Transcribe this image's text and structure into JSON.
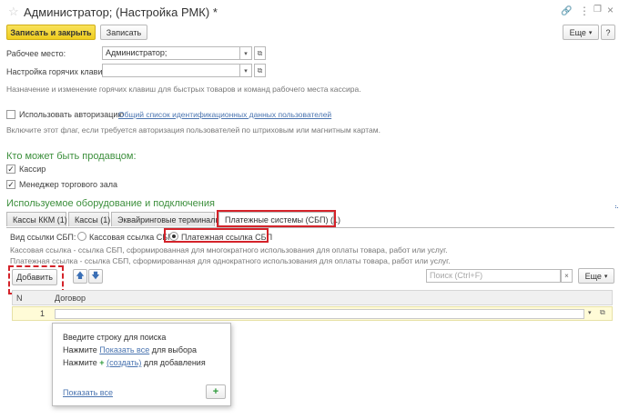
{
  "header": {
    "title": "Администратор; (Настройка РМК) *",
    "star_icon": "star-icon",
    "more_icon": "more-options-icon",
    "restore_icon": "restore-window-icon",
    "close_icon": "close-icon"
  },
  "toolbar": {
    "save_close_label": "Записать и закрыть",
    "save_label": "Записать",
    "more_label": "Еще",
    "help_label": "?"
  },
  "form": {
    "workplace_label": "Рабочее место:",
    "workplace_value": "Администратор;",
    "hotkeys_label": "Настройка горячих клавиш:",
    "hotkeys_value": "",
    "hotkeys_hint": "Назначение и изменение горячих клавиш для быстрых товаров и команд рабочего места кассира.",
    "use_auth_label": "Использовать авторизацию",
    "use_auth_checked": false,
    "user_ids_link": "Общий список идентификационных данных пользователей",
    "auth_hint": "Включите этот флаг, если требуется авторизация пользователей по штриховым или магнитным картам."
  },
  "seller": {
    "heading": "Кто может быть продавцом:",
    "options": [
      {
        "label": "Кассир",
        "checked": true
      },
      {
        "label": "Менеджер торгового зала",
        "checked": true
      }
    ]
  },
  "equipment": {
    "heading": "Используемое оборудование и подключения",
    "tabs": [
      {
        "label": "Кассы ККМ (1)",
        "active": false
      },
      {
        "label": "Кассы (1)",
        "active": false
      },
      {
        "label": "Эквайринговые терминалы",
        "active": false
      },
      {
        "label": "Платежные системы (СБП) (1)",
        "active": true
      }
    ]
  },
  "sbp": {
    "link_type_label": "Вид ссылки СБП:",
    "radio_cash": "Кассовая ссылка СБП",
    "radio_payment": "Платежная ссылка СБП",
    "selected": "payment",
    "desc_cash": "Кассовая ссылка - ссылка СБП, сформированная для многократного использования для оплаты товара, работ или услуг.",
    "desc_payment": "Платежная ссылка - ссылка СБП, сформированная для однократного использования для оплаты товара, работ или услуг."
  },
  "table_toolbar": {
    "add_label": "Добавить",
    "up_icon": "arrow-up-icon",
    "down_icon": "arrow-down-icon",
    "search_placeholder": "Поиск (Ctrl+F)",
    "more_label": "Еще"
  },
  "table": {
    "col_num": "N",
    "col_contract": "Договор",
    "rows": [
      {
        "num": "1",
        "contract": ""
      }
    ]
  },
  "popup": {
    "line1": "Введите строку для поиска",
    "line2_prefix": "Нажмите",
    "line2_link": "Показать все",
    "line2_suffix": "для выбора",
    "line3_prefix": "Нажмите",
    "line3_link": "(создать)",
    "line3_suffix": "для добавления",
    "show_all": "Показать все"
  },
  "colors": {
    "accent_yellow": "#f4d635",
    "section_green": "#3c8f3c",
    "link_blue": "#4a74b0",
    "highlight_red": "#d4232a",
    "add_green": "#2d9a3a"
  }
}
